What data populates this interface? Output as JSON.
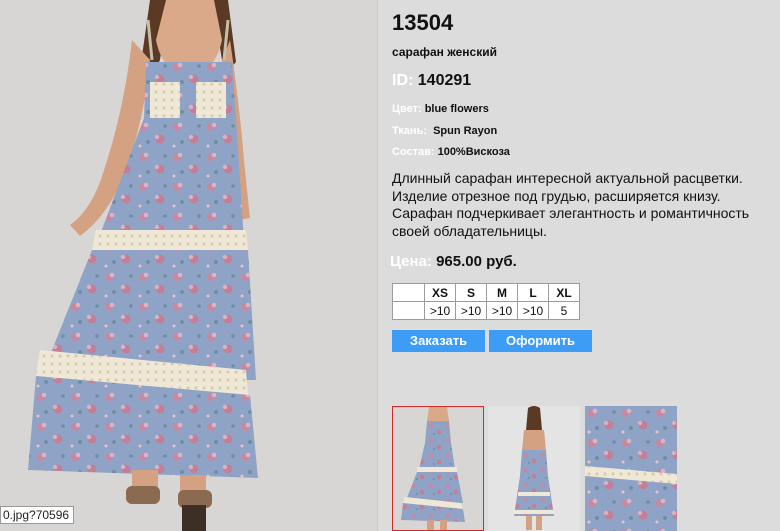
{
  "product": {
    "article": "13504",
    "name": "сарафан женский",
    "id_label": "ID:",
    "id_value": "140291",
    "color_label": "Цвет:",
    "color_value": "blue flowers",
    "fabric_label": "Ткань:",
    "fabric_value": "Spun Rayon",
    "composition_label": "Состав:",
    "composition_value": "100%Вискоза",
    "description": "Длинный сарафан интересной актуальной расцветки. Изделие отрезное под грудью, расширяется книзу. Сарафан подчеркивает элегантность и романтичность своей обладательницы.",
    "price_label": "Цена:",
    "price_value": "965.00 руб."
  },
  "sizes": {
    "headers": [
      "XS",
      "S",
      "M",
      "L",
      "XL"
    ],
    "stock": [
      ">10",
      ">10",
      ">10",
      ">10",
      "5"
    ]
  },
  "buttons": {
    "order": "Заказать",
    "checkout": "Оформить"
  },
  "status_tip": "0.jpg?70596",
  "thumbnails": [
    {
      "icon": "dress-front-thumbnail",
      "selected": true
    },
    {
      "icon": "dress-back-thumbnail",
      "selected": false
    },
    {
      "icon": "fabric-closeup-thumbnail",
      "selected": false
    }
  ],
  "colors": {
    "background": "#dcdcdc",
    "button": "#3d9cf5",
    "label_white": "#ffffff",
    "selected_border": "#d62a2a",
    "dress_blue": "#8fa3c7",
    "lace": "#efe8d6"
  }
}
